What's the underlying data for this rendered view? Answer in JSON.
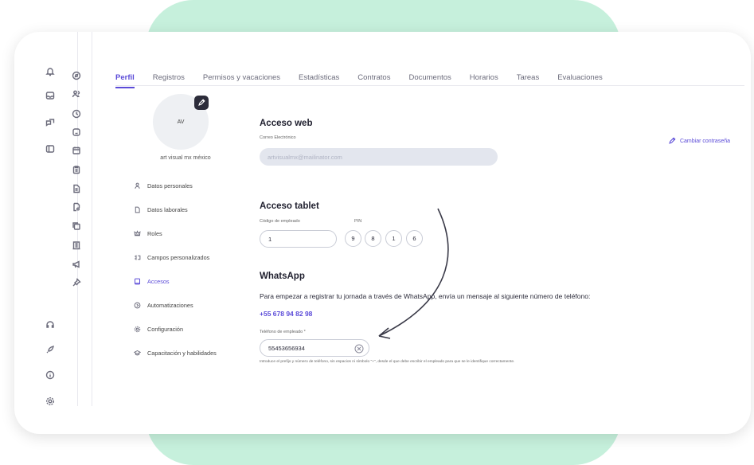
{
  "tabs": [
    "Perfil",
    "Registros",
    "Permisos y vacaciones",
    "Estadísticas",
    "Contratos",
    "Documentos",
    "Horarios",
    "Tareas",
    "Evaluaciones"
  ],
  "profile": {
    "initials": "AV",
    "name": "art visual mx méxico"
  },
  "menu": [
    {
      "label": "Datos personales",
      "icon": "person-icon"
    },
    {
      "label": "Datos laborales",
      "icon": "document-icon"
    },
    {
      "label": "Roles",
      "icon": "crown-icon"
    },
    {
      "label": "Campos personalizados",
      "icon": "custom-fields-icon"
    },
    {
      "label": "Accesos",
      "icon": "access-icon",
      "active": true
    },
    {
      "label": "Automatizaciones",
      "icon": "automation-icon"
    },
    {
      "label": "Configuración",
      "icon": "gear-icon"
    },
    {
      "label": "Capacitación y habilidades",
      "icon": "graduation-cap-icon"
    }
  ],
  "web_access": {
    "title": "Acceso web",
    "email_label": "Correo Electrónico",
    "email_value": "artvisualmx@mailinator.com",
    "change_password": "Cambiar contraseña"
  },
  "tablet_access": {
    "title": "Acceso tablet",
    "code_label": "Código de empleado",
    "code_value": "1",
    "pin_label": "PIN",
    "pin_digits": [
      "9",
      "8",
      "1",
      "6"
    ]
  },
  "whatsapp": {
    "title": "WhatsApp",
    "instructions": "Para empezar a registrar tu jornada a través de WhatsApp, envía un mensaje al siguiente número de teléfono:",
    "number": "+55 678 94 82 98",
    "phone_label": "Teléfono de empleado *",
    "phone_value": "55453656934",
    "hint": "Introduce el prefijo y número de teléfono, sin espacios ni símbolo \"+\", desde el que debe escribir el empleado para que se le identifique correctamente."
  },
  "colors": {
    "accent": "#5b4bd8",
    "mint": "#c6f0dc"
  }
}
